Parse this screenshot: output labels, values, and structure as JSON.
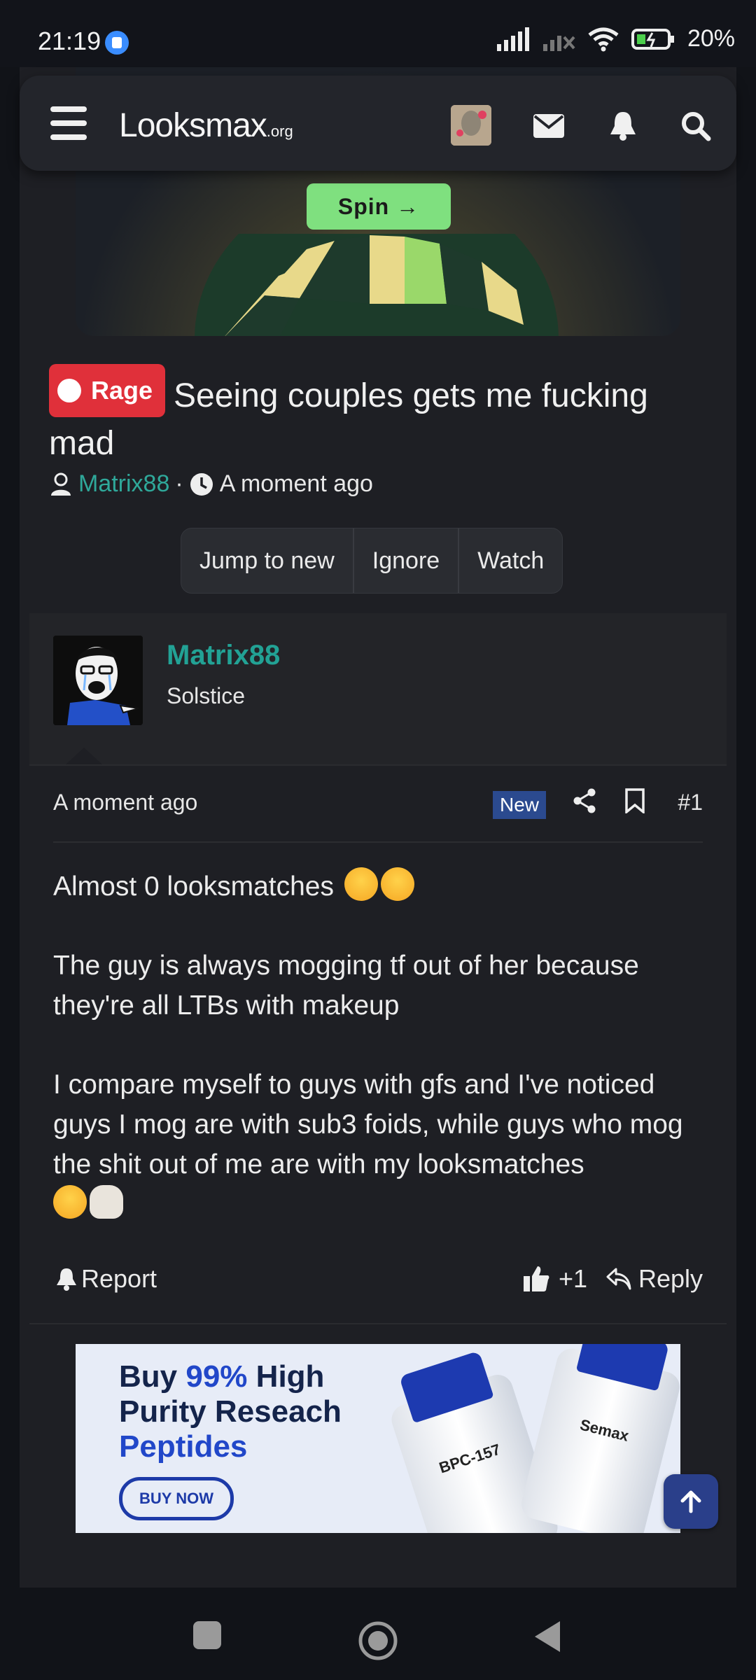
{
  "status_bar": {
    "time": "21:19",
    "battery": "20%"
  },
  "nav": {
    "logo_main": "Looksmax",
    "logo_suffix": ".org"
  },
  "banner": {
    "spin_label": "Spin →"
  },
  "thread": {
    "prefix": "Rage",
    "title": "Seeing couples gets me fucking mad",
    "author": "Matrix88",
    "time": "A moment ago",
    "buttons": [
      "Jump to new",
      "Ignore",
      "Watch"
    ]
  },
  "post": {
    "username": "Matrix88",
    "user_title": "Solstice",
    "time": "A moment ago",
    "new_badge": "New",
    "number": "#1",
    "paragraphs": [
      "Almost 0 looksmatches",
      "The guy is always mogging tf out of her because they're all LTBs with makeup",
      "I compare myself to guys with gfs and I've noticed guys I mog are with sub3 foids, while guys who mog the shit out of me are with my looksmatches"
    ],
    "report_label": "Report",
    "like_count": "+1",
    "reply_label": "Reply"
  },
  "ad": {
    "line1": "Buy ",
    "highlight1": "99%",
    "line1b": " High",
    "line2": "Purity Reseach",
    "line3": "Peptides",
    "button": "BUY NOW",
    "vial1": "BPC-157",
    "vial2": "Semax"
  },
  "colors": {
    "accent": "#22a295",
    "rage": "#e0303a",
    "new_badge": "#2b4a8f"
  }
}
